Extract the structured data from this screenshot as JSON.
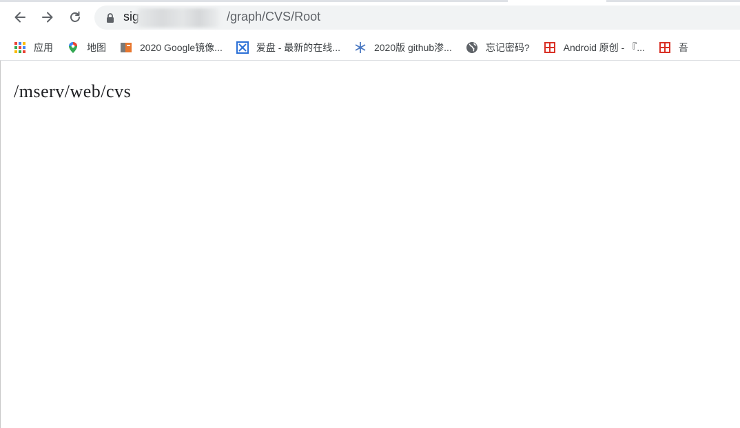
{
  "browser": {
    "url_host_visible": "sig",
    "url_path": "/graph/CVS/Root"
  },
  "bookmarks": [
    {
      "icon": "apps-grid-icon",
      "label": "应用"
    },
    {
      "icon": "maps-pin-icon",
      "label": "地图"
    },
    {
      "icon": "book-orange-icon",
      "label": "2020 Google镜像..."
    },
    {
      "icon": "blue-x-icon",
      "label": "爱盘 - 最新的在线..."
    },
    {
      "icon": "snowflake-icon",
      "label": "2020版 github渗..."
    },
    {
      "icon": "globe-icon",
      "label": "忘记密码?"
    },
    {
      "icon": "red-seal-icon",
      "label": "Android 原创 - 『..."
    },
    {
      "icon": "red-seal-icon",
      "label": "吾"
    }
  ],
  "page": {
    "text": "/mserv/web/cvs"
  },
  "colors": {
    "omnibox_bg": "#f1f3f4",
    "text": "#202124"
  }
}
